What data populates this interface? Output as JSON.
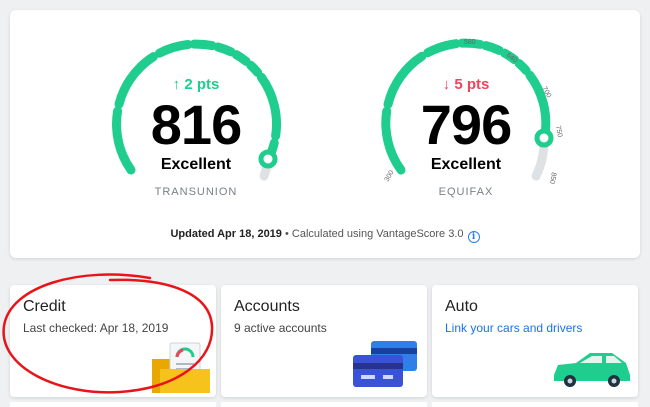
{
  "transunion": {
    "change": "↑ 2 pts",
    "score": "816",
    "rating": "Excellent",
    "bureau": "TRANSUNION"
  },
  "equifax": {
    "change": "↓ 5 pts",
    "score": "796",
    "rating": "Excellent",
    "bureau": "EQUIFAX",
    "ticks": [
      "300",
      "580",
      "640",
      "700",
      "750",
      "850"
    ]
  },
  "footer": {
    "updated": "Updated Apr 18, 2019",
    "separator": " • ",
    "calc": "Calculated using VantageScore 3.0"
  },
  "tiles": {
    "credit": {
      "title": "Credit",
      "subtitle": "Last checked: Apr 18, 2019"
    },
    "accounts": {
      "title": "Accounts",
      "subtitle": "9 active accounts"
    },
    "auto": {
      "title": "Auto",
      "subtitle": "Link your cars and drivers"
    }
  },
  "colors": {
    "gauge_green": "#1fcd8e",
    "gauge_track": "#dfe2e5",
    "up": "#1fcd8e",
    "down": "#f0445b",
    "link": "#1a73e8",
    "annotation": "#e8141a"
  },
  "icons": {
    "info": "info-icon",
    "credit": "folder-report-icon",
    "accounts": "credit-cards-icon",
    "auto": "car-icon"
  }
}
